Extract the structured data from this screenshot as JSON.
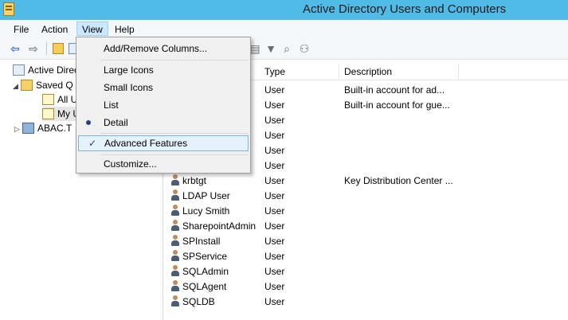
{
  "window": {
    "title": "Active Directory Users and Computers"
  },
  "menubar": {
    "items": [
      "File",
      "Action",
      "View",
      "Help"
    ],
    "open": "View"
  },
  "view_menu": {
    "items": [
      {
        "label": "Add/Remove Columns...",
        "mark": ""
      },
      {
        "label": "Large Icons",
        "mark": ""
      },
      {
        "label": "Small Icons",
        "mark": ""
      },
      {
        "label": "List",
        "mark": ""
      },
      {
        "label": "Detail",
        "mark": "radio"
      },
      {
        "label": "Advanced Features",
        "mark": "check"
      },
      {
        "label": "Customize...",
        "mark": ""
      }
    ],
    "check_glyph": "✓"
  },
  "toolbar": {
    "back_icon": "back-arrow-icon",
    "forward_icon": "forward-arrow-icon",
    "back_glyph": "⇦",
    "forward_glyph": "⇨",
    "filter_glyph": "▼",
    "query_glyph": "⌕",
    "users_glyph": "⚇",
    "misc_glyph": "▤"
  },
  "tree": {
    "items": [
      {
        "label": "Active Directo",
        "level": 0
      },
      {
        "label": "Saved Q",
        "level": 1
      },
      {
        "label": "All U",
        "level": 2
      },
      {
        "label": "My U",
        "level": 2,
        "selected": true
      },
      {
        "label": "ABAC.T",
        "level": 0
      }
    ],
    "collapse_glyph": "◢",
    "expand_glyph": "▷"
  },
  "list": {
    "columns": [
      "Type",
      "Description"
    ],
    "rows": [
      {
        "name": "",
        "type": "User",
        "desc": "Built-in account for ad..."
      },
      {
        "name": "",
        "type": "User",
        "desc": "Built-in account for gue..."
      },
      {
        "name": "",
        "type": "User",
        "desc": ""
      },
      {
        "name": "",
        "type": "User",
        "desc": ""
      },
      {
        "name": "",
        "type": "User",
        "desc": ""
      },
      {
        "name": "",
        "type": "User",
        "desc": ""
      },
      {
        "name": "krbtgt",
        "type": "User",
        "desc": "Key Distribution Center ..."
      },
      {
        "name": "LDAP User",
        "type": "User",
        "desc": ""
      },
      {
        "name": "Lucy Smith",
        "type": "User",
        "desc": ""
      },
      {
        "name": "SharepointAdmin",
        "type": "User",
        "desc": ""
      },
      {
        "name": "SPInstall",
        "type": "User",
        "desc": ""
      },
      {
        "name": "SPService",
        "type": "User",
        "desc": ""
      },
      {
        "name": "SQLAdmin",
        "type": "User",
        "desc": ""
      },
      {
        "name": "SQLAgent",
        "type": "User",
        "desc": ""
      },
      {
        "name": "SQLDB",
        "type": "User",
        "desc": ""
      }
    ]
  }
}
